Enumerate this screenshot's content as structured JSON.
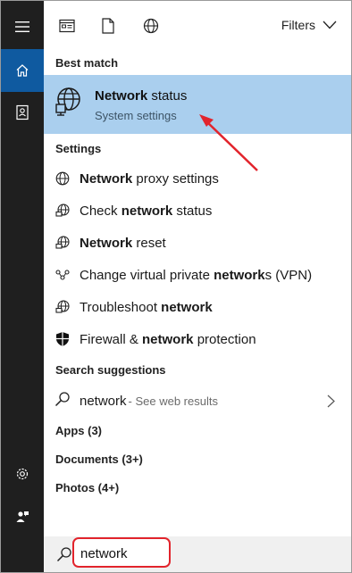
{
  "topbar": {
    "filters_label": "Filters"
  },
  "sections": {
    "best_match": "Best match",
    "settings": "Settings",
    "search_suggestions": "Search suggestions"
  },
  "best_match": {
    "title_bold": "Network",
    "title_rest": " status",
    "subtitle": "System settings"
  },
  "settings_items": [
    {
      "pre": "",
      "bold": "Network",
      "post": " proxy settings",
      "icon": "globe-icon"
    },
    {
      "pre": "Check ",
      "bold": "network",
      "post": " status",
      "icon": "network-status-icon"
    },
    {
      "pre": "",
      "bold": "Network",
      "post": " reset",
      "icon": "network-reset-icon"
    },
    {
      "pre": "Change virtual private ",
      "bold": "network",
      "post": "s (VPN)",
      "icon": "vpn-icon"
    },
    {
      "pre": "Troubleshoot ",
      "bold": "network",
      "post": "",
      "icon": "troubleshoot-icon"
    },
    {
      "pre": "Firewall & ",
      "bold": "network",
      "post": " protection",
      "icon": "shield-icon"
    }
  ],
  "suggestion": {
    "term": "network",
    "web_hint": " - See web results"
  },
  "categories": {
    "apps": "Apps (3)",
    "documents": "Documents (3+)",
    "photos": "Photos (4+)"
  },
  "search": {
    "query": "network"
  },
  "colors": {
    "rail": "#1f1f1f",
    "rail_active": "#0f5aa0",
    "best_match_bg": "#aacfee",
    "annotation_red": "#e2242c"
  }
}
